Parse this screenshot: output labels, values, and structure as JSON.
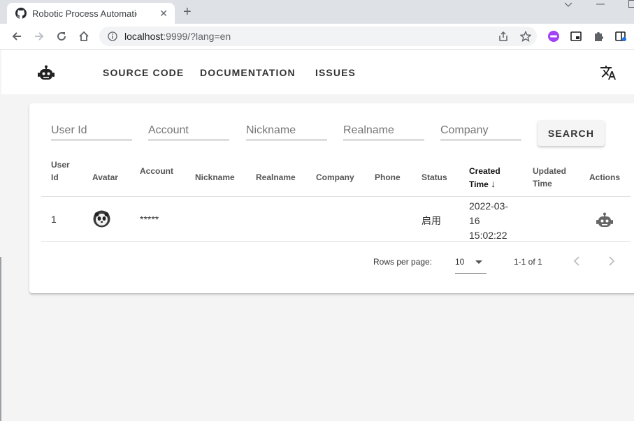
{
  "browser": {
    "tab_title": "Robotic Process Automation Tool",
    "tab_close": "✕",
    "new_tab": "+",
    "url_host": "localhost",
    "url_rest": ":9999/?lang=en"
  },
  "nav": {
    "links": [
      "SOURCE CODE",
      "DOCUMENTATION",
      "ISSUES"
    ]
  },
  "search": {
    "placeholders": [
      "User Id",
      "Account",
      "Nickname",
      "Realname",
      "Company"
    ],
    "button_label": "SEARCH"
  },
  "table": {
    "headers": [
      "User\nId",
      "Avatar",
      "Account",
      "Nickname",
      "Realname",
      "Company",
      "Phone",
      "Status",
      "Created\nTime",
      "Updated\nTime",
      "Actions"
    ],
    "sort_indicator": "↓",
    "rows": [
      {
        "user_id": "1",
        "account": "*****",
        "nickname": "",
        "realname": "",
        "company": "",
        "phone": "",
        "status": "启用",
        "created_time": "2022-03-\n16\n15:02:22",
        "updated_time": ""
      }
    ]
  },
  "pagination": {
    "rows_per_page_label": "Rows per page:",
    "rows_per_page_value": "10",
    "range": "1-1 of 1"
  }
}
